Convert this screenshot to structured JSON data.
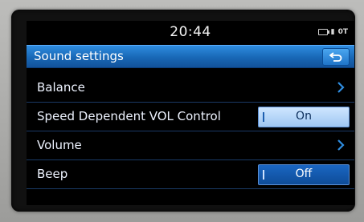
{
  "status": {
    "time": "20:44",
    "indicators": "℩━ ▓ 0T▖"
  },
  "header": {
    "title": "Sound settings",
    "back_icon": "back-arrow-icon"
  },
  "menu": {
    "items": [
      {
        "label": "Balance",
        "control": "chevron"
      },
      {
        "label": "Speed Dependent VOL Control",
        "control": "toggle",
        "value": "On"
      },
      {
        "label": "Volume",
        "control": "chevron"
      },
      {
        "label": "Beep",
        "control": "toggle",
        "value": "Off"
      }
    ]
  },
  "colors": {
    "accent": "#1f74c8",
    "chevron": "#2f8de0"
  }
}
